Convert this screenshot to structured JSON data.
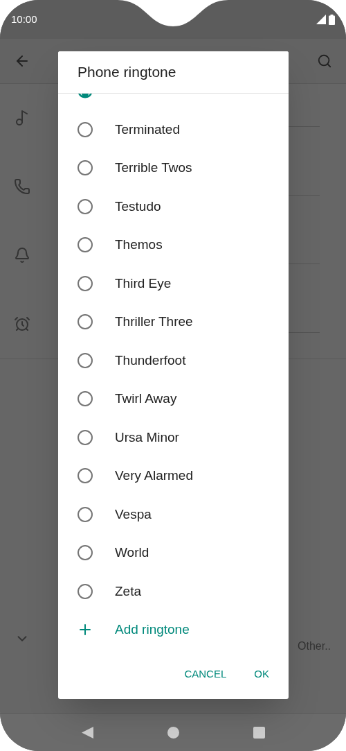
{
  "status_bar": {
    "time": "10:00"
  },
  "background": {
    "footer_text": "Other.."
  },
  "dialog": {
    "title": "Phone ringtone",
    "partial_option": {
      "selected": true
    },
    "options": [
      {
        "label": "Terminated",
        "selected": false
      },
      {
        "label": "Terrible Twos",
        "selected": false
      },
      {
        "label": "Testudo",
        "selected": false
      },
      {
        "label": "Themos",
        "selected": false
      },
      {
        "label": "Third Eye",
        "selected": false
      },
      {
        "label": "Thriller Three",
        "selected": false
      },
      {
        "label": "Thunderfoot",
        "selected": false
      },
      {
        "label": "Twirl Away",
        "selected": false
      },
      {
        "label": "Ursa Minor",
        "selected": false
      },
      {
        "label": "Very Alarmed",
        "selected": false
      },
      {
        "label": "Vespa",
        "selected": false
      },
      {
        "label": "World",
        "selected": false
      },
      {
        "label": "Zeta",
        "selected": false
      }
    ],
    "add_action": "Add ringtone",
    "buttons": [
      "CANCEL",
      "OK"
    ]
  }
}
